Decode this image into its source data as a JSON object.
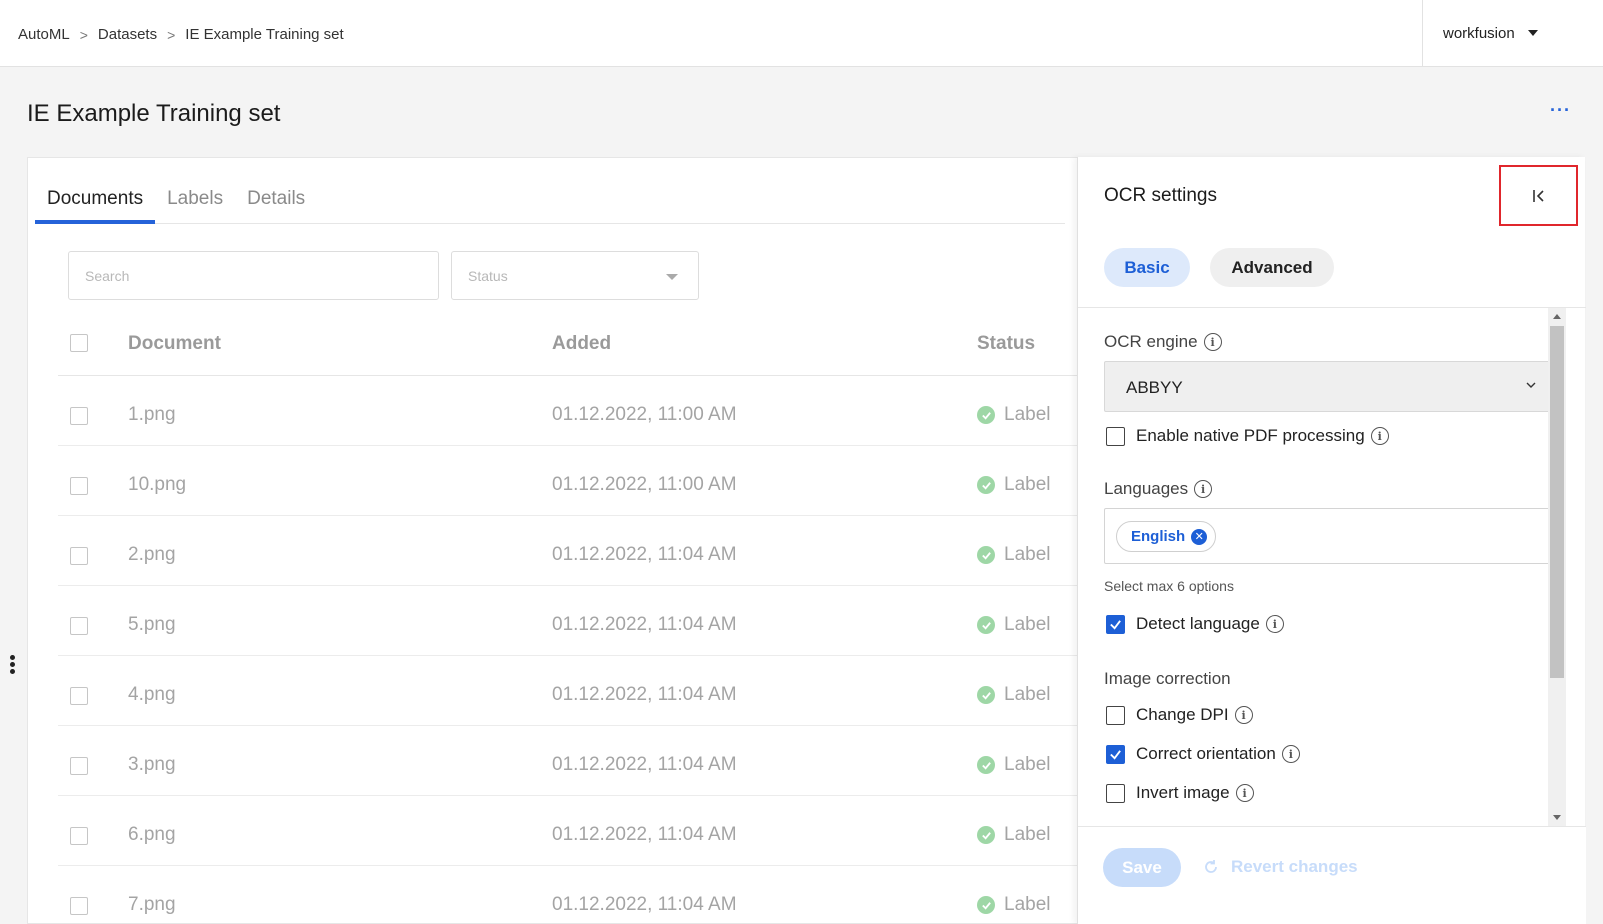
{
  "breadcrumb": [
    "AutoML",
    "Datasets",
    "IE Example Training set"
  ],
  "user": {
    "name": "workfusion"
  },
  "page": {
    "title": "IE Example Training set",
    "more": "···"
  },
  "tabs": [
    "Documents",
    "Labels",
    "Details"
  ],
  "filters": {
    "search_placeholder": "Search",
    "status_placeholder": "Status"
  },
  "table": {
    "columns": [
      "Document",
      "Added",
      "Status"
    ],
    "rows": [
      {
        "document": "1.png",
        "added": "01.12.2022, 11:00 AM",
        "status": "Label"
      },
      {
        "document": "10.png",
        "added": "01.12.2022, 11:00 AM",
        "status": "Label"
      },
      {
        "document": "2.png",
        "added": "01.12.2022, 11:04 AM",
        "status": "Label"
      },
      {
        "document": "5.png",
        "added": "01.12.2022, 11:04 AM",
        "status": "Label"
      },
      {
        "document": "4.png",
        "added": "01.12.2022, 11:04 AM",
        "status": "Label"
      },
      {
        "document": "3.png",
        "added": "01.12.2022, 11:04 AM",
        "status": "Label"
      },
      {
        "document": "6.png",
        "added": "01.12.2022, 11:04 AM",
        "status": "Label"
      },
      {
        "document": "7.png",
        "added": "01.12.2022, 11:04 AM",
        "status": "Label"
      }
    ]
  },
  "ocr": {
    "title": "OCR settings",
    "tabs": {
      "basic": "Basic",
      "advanced": "Advanced"
    },
    "engine_label": "OCR engine",
    "engine_value": "ABBYY",
    "native_pdf": {
      "label": "Enable native PDF processing",
      "checked": false
    },
    "languages_label": "Languages",
    "language_chip": "English",
    "languages_hint": "Select max 6 options",
    "detect_language": {
      "label": "Detect language",
      "checked": true
    },
    "image_correction_label": "Image correction",
    "change_dpi": {
      "label": "Change DPI",
      "checked": false
    },
    "correct_orientation": {
      "label": "Correct orientation",
      "checked": true
    },
    "invert_image": {
      "label": "Invert image",
      "checked": false
    },
    "save_label": "Save",
    "revert_label": "Revert changes"
  },
  "colors": {
    "accent": "#1d5fd6",
    "highlight": "#e0262c",
    "success": "#9ed7a6"
  }
}
